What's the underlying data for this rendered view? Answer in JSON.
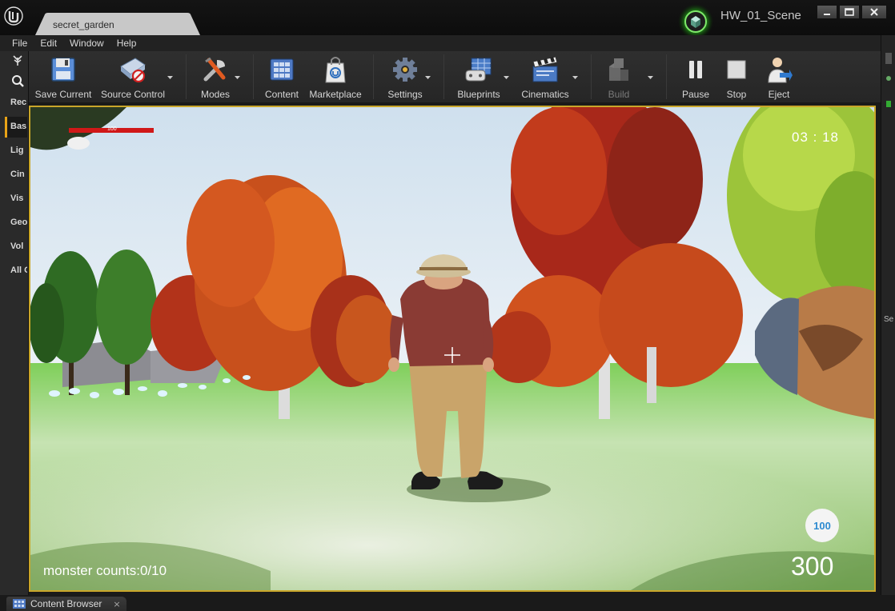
{
  "window": {
    "document_tab": "secret_garden",
    "project_name": "HW_01_Scene",
    "controls": [
      "minimize-icon",
      "maximize-icon",
      "close-icon"
    ]
  },
  "menu": {
    "items": [
      "File",
      "Edit",
      "Window",
      "Help"
    ]
  },
  "left_panel": {
    "categories": [
      "Rec",
      "Bas",
      "Lig",
      "Cin",
      "Vis",
      "Geo",
      "Vol",
      "All C"
    ],
    "active_category": "Bas"
  },
  "toolbar": {
    "buttons": [
      {
        "label": "Save Current",
        "icon": "save-icon"
      },
      {
        "label": "Source Control",
        "icon": "source-control-icon"
      },
      {
        "label": "Modes",
        "icon": "modes-icon"
      },
      {
        "label": "Content",
        "icon": "content-icon"
      },
      {
        "label": "Marketplace",
        "icon": "marketplace-icon"
      },
      {
        "label": "Settings",
        "icon": "settings-icon"
      },
      {
        "label": "Blueprints",
        "icon": "blueprints-icon"
      },
      {
        "label": "Cinematics",
        "icon": "cinematics-icon"
      },
      {
        "label": "Build",
        "icon": "build-icon"
      },
      {
        "label": "Pause",
        "icon": "pause-icon"
      },
      {
        "label": "Stop",
        "icon": "stop-icon"
      },
      {
        "label": "Eject",
        "icon": "eject-icon"
      }
    ]
  },
  "hud": {
    "health_value": "100",
    "health_fraction": 1.0,
    "timer": "03 : 18",
    "monster_counts": "monster counts:0/10",
    "ammo_clip": "100",
    "ammo_total": "300"
  },
  "right_strip": {
    "text": "Se"
  },
  "bottom": {
    "tab_label": "Content Browser",
    "close": "×"
  },
  "colors": {
    "viewport_border": "#c9a62a",
    "health_bar": "#d01818",
    "ammo_text": "#2d8ad0",
    "active_category_accent": "#e8a317"
  }
}
